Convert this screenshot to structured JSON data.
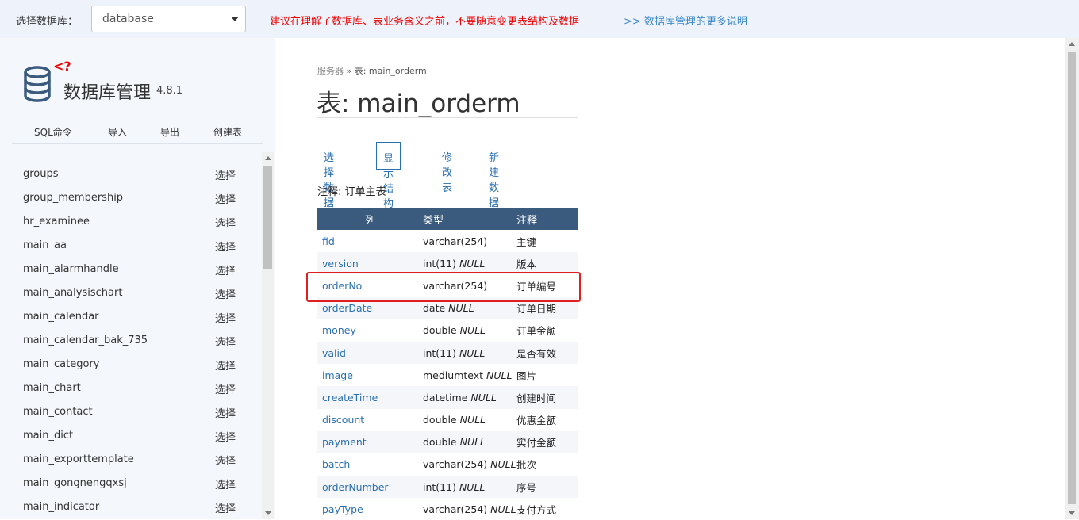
{
  "topbar": {
    "db_label": "选择数据库：",
    "db_value": "database",
    "warning": "建议在理解了数据库、表业务含义之前，不要随意变更表结构及数据",
    "more_link": ">> 数据库管理的更多说明"
  },
  "sidebar": {
    "logo_badge": "<?",
    "app_title": "数据库管理",
    "version": "4.8.1",
    "commands": [
      "SQL命令",
      "导入",
      "导出",
      "创建表"
    ],
    "select_label": "选择",
    "tables": [
      "groups",
      "group_membership",
      "hr_examinee",
      "main_aa",
      "main_alarmhandle",
      "main_analysischart",
      "main_calendar",
      "main_calendar_bak_735",
      "main_category",
      "main_chart",
      "main_contact",
      "main_dict",
      "main_exporttemplate",
      "main_gongnengqxsj",
      "main_indicator"
    ]
  },
  "main": {
    "breadcrumb_server": "服务器",
    "breadcrumb_sep": " » ",
    "breadcrumb_current": "表: main_orderm",
    "title": "表: main_orderm",
    "tabs": [
      "选择数据",
      "显示结构",
      "修改表",
      "新建数据"
    ],
    "active_tab": "显示结构",
    "comment": "注释: 订单主表",
    "columns_header": [
      "列",
      "类型",
      "注释"
    ],
    "null_label": "NULL",
    "rows": [
      {
        "name": "fid",
        "type": "varchar(254)",
        "nullable": false,
        "comment": "主键"
      },
      {
        "name": "version",
        "type": "int(11)",
        "nullable": true,
        "comment": "版本"
      },
      {
        "name": "orderNo",
        "type": "varchar(254)",
        "nullable": false,
        "comment": "订单编号"
      },
      {
        "name": "orderDate",
        "type": "date",
        "nullable": true,
        "comment": "订单日期"
      },
      {
        "name": "money",
        "type": "double",
        "nullable": true,
        "comment": "订单金额"
      },
      {
        "name": "valid",
        "type": "int(11)",
        "nullable": true,
        "comment": "是否有效"
      },
      {
        "name": "image",
        "type": "mediumtext",
        "nullable": true,
        "comment": "图片"
      },
      {
        "name": "createTime",
        "type": "datetime",
        "nullable": true,
        "comment": "创建时间"
      },
      {
        "name": "discount",
        "type": "double",
        "nullable": true,
        "comment": "优惠金额"
      },
      {
        "name": "payment",
        "type": "double",
        "nullable": true,
        "comment": "实付金额"
      },
      {
        "name": "batch",
        "type": "varchar(254)",
        "nullable": true,
        "comment": "批次"
      },
      {
        "name": "orderNumber",
        "type": "int(11)",
        "nullable": true,
        "comment": "序号"
      },
      {
        "name": "payType",
        "type": "varchar(254)",
        "nullable": true,
        "comment": "支付方式"
      }
    ],
    "highlighted_row": "orderNo"
  },
  "colors": {
    "warning": "#ee0000",
    "link": "#2a6fb0",
    "table_header": "#3b5b7e",
    "highlight": "#e02020"
  }
}
